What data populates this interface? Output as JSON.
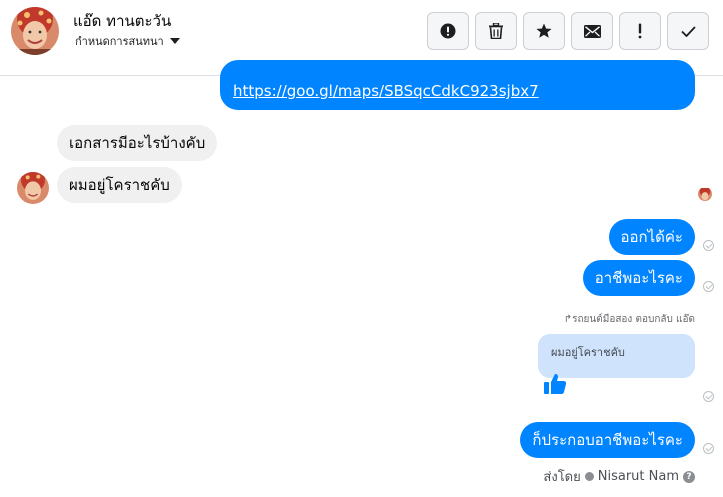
{
  "header": {
    "contact_name": "แอ๊ด ทานตะวัน",
    "conversation_settings": "กำหนดการสนทนา",
    "toolbar": [
      {
        "icon": "alert-circle-icon",
        "name": "report-button"
      },
      {
        "icon": "trash-icon",
        "name": "delete-button"
      },
      {
        "icon": "star-icon",
        "name": "star-button"
      },
      {
        "icon": "envelope-icon",
        "name": "mark-unread-button"
      },
      {
        "icon": "exclamation-icon",
        "name": "spam-button"
      },
      {
        "icon": "checkmark-icon",
        "name": "done-button"
      }
    ]
  },
  "thread": {
    "link_message": "https://goo.gl/maps/SBSqcCdkC923sjbx7",
    "incoming": [
      "เอกสารมีอะไรบ้างคับ",
      "ผมอยู่โคราชคับ"
    ],
    "outgoing": [
      "ออกได้ค่ะ",
      "อาชีพอะไรคะ"
    ],
    "reply_meta": "รถยนต์มือสอง ตอบกลับ แอ๊ด",
    "reply_quote": "ผมอยู่โคราชคับ",
    "final_message": "ก็ประกอบอาชีพอะไรคะ",
    "sent_by_label": "ส่งโดย",
    "sent_by_name": "Nisarut Nam"
  },
  "colors": {
    "outgoing_bubble": "#0084ff",
    "incoming_bubble": "#f0f0f0",
    "reply_bubble": "#cfe3fc"
  }
}
